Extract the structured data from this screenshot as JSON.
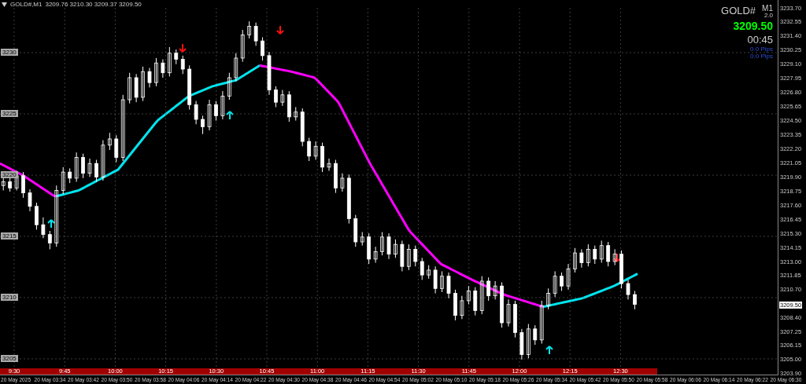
{
  "header": {
    "symbol": "GOLD#,M1",
    "quote": "3209.76 3210.30 3209.37 3209.50"
  },
  "info_panel": {
    "symbol": "GOLD#",
    "timeframe": "M1",
    "version": "2.0",
    "price": "3209.50",
    "countdown": "00:45",
    "pips": [
      "0.0 Pips",
      "0.0 Pips"
    ]
  },
  "price_chart": {
    "chart_data": {
      "type": "candlestick",
      "ylim": [
        3203.9,
        3233.7
      ],
      "grid": true,
      "yticks": [
        {
          "value": 3233.7,
          "label": "3233.70"
        },
        {
          "value": 3232.55,
          "label": "3232.55"
        },
        {
          "value": 3231.4,
          "label": "3231.40"
        },
        {
          "value": 3230.25,
          "label": "3230.25"
        },
        {
          "value": 3229.1,
          "label": "3229.10"
        },
        {
          "value": 3227.95,
          "label": "3227.95"
        },
        {
          "value": 3226.8,
          "label": "3226.80"
        },
        {
          "value": 3225.65,
          "label": "3225.65"
        },
        {
          "value": 3224.5,
          "label": "3224.50"
        },
        {
          "value": 3223.35,
          "label": "3223.35"
        },
        {
          "value": 3222.2,
          "label": "3222.20"
        },
        {
          "value": 3221.05,
          "label": "3221.05"
        },
        {
          "value": 3219.9,
          "label": "3219.90"
        },
        {
          "value": 3218.75,
          "label": "3218.75"
        },
        {
          "value": 3217.6,
          "label": "3217.60"
        },
        {
          "value": 3216.45,
          "label": "3216.45"
        },
        {
          "value": 3215.3,
          "label": "3215.30"
        },
        {
          "value": 3214.15,
          "label": "3214.15"
        },
        {
          "value": 3213.0,
          "label": "3213.00"
        },
        {
          "value": 3211.85,
          "label": "3211.85"
        },
        {
          "value": 3210.7,
          "label": "3210.70"
        },
        {
          "value": 3208.4,
          "label": "3208.40"
        },
        {
          "value": 3207.25,
          "label": "3207.25"
        },
        {
          "value": 3206.15,
          "label": "3206.15"
        },
        {
          "value": 3205.0,
          "label": "3205.00"
        },
        {
          "value": 3203.9,
          "label": "3203.90"
        }
      ],
      "categories": [
        null,
        null,
        null,
        null,
        null,
        null,
        null,
        null,
        null,
        null,
        null,
        null,
        null,
        null,
        null,
        null,
        null,
        null,
        null,
        null,
        null,
        null,
        null,
        null,
        null,
        null,
        null,
        null,
        null,
        null,
        null,
        null,
        null,
        null,
        null,
        null,
        null,
        null,
        null,
        null,
        null,
        null,
        null,
        null,
        null,
        null,
        null,
        null,
        null,
        null,
        null,
        null,
        null,
        null,
        null,
        null,
        null,
        null,
        null,
        null,
        null,
        null,
        null,
        null,
        null,
        null,
        null,
        null,
        null,
        null,
        null,
        null,
        null,
        null,
        null,
        null,
        null,
        null,
        null,
        null,
        null,
        null,
        null,
        null,
        null,
        null,
        null,
        null,
        null,
        null,
        null,
        null,
        null,
        null,
        null,
        null,
        null,
        null,
        null,
        null,
        null,
        null,
        null,
        null,
        null,
        null,
        null,
        null,
        null,
        null,
        null,
        null,
        null,
        null,
        null,
        null,
        null
      ],
      "ohlc": [
        [
          3219.2,
          3219.9,
          3218.8,
          3219.5
        ],
        [
          3219.5,
          3219.8,
          3218.7,
          3219.0
        ],
        [
          3219.0,
          3220.4,
          3218.8,
          3220.0
        ],
        [
          3220.0,
          3220.3,
          3218.2,
          3218.6
        ],
        [
          3218.6,
          3218.9,
          3217.1,
          3217.5
        ],
        [
          3217.5,
          3217.8,
          3215.6,
          3216.0
        ],
        [
          3216.0,
          3216.6,
          3214.9,
          3215.2
        ],
        [
          3215.2,
          3215.5,
          3214.0,
          3214.5
        ],
        [
          3214.5,
          3219.2,
          3214.2,
          3218.8
        ],
        [
          3218.8,
          3220.7,
          3218.5,
          3220.3
        ],
        [
          3220.3,
          3220.6,
          3219.4,
          3219.8
        ],
        [
          3219.8,
          3221.9,
          3219.5,
          3221.5
        ],
        [
          3221.5,
          3221.8,
          3219.8,
          3220.2
        ],
        [
          3220.2,
          3221.4,
          3219.9,
          3221.0
        ],
        [
          3221.0,
          3221.3,
          3219.5,
          3219.9
        ],
        [
          3219.9,
          3222.9,
          3219.6,
          3222.5
        ],
        [
          3222.5,
          3223.5,
          3222.1,
          3223.0
        ],
        [
          3223.0,
          3223.3,
          3221.1,
          3221.5
        ],
        [
          3221.5,
          3226.6,
          3221.2,
          3226.2
        ],
        [
          3226.2,
          3228.4,
          3225.9,
          3228.0
        ],
        [
          3228.0,
          3228.3,
          3226.0,
          3226.4
        ],
        [
          3226.4,
          3228.9,
          3226.1,
          3228.5
        ],
        [
          3228.5,
          3228.8,
          3227.2,
          3227.6
        ],
        [
          3227.6,
          3229.6,
          3227.3,
          3229.2
        ],
        [
          3229.2,
          3229.5,
          3228.0,
          3228.4
        ],
        [
          3228.4,
          3230.5,
          3228.1,
          3230.0
        ],
        [
          3230.0,
          3230.3,
          3229.1,
          3229.5
        ],
        [
          3229.5,
          3229.8,
          3228.3,
          3228.7
        ],
        [
          3228.7,
          3229.0,
          3225.4,
          3225.8
        ],
        [
          3225.8,
          3226.1,
          3224.2,
          3224.6
        ],
        [
          3224.6,
          3224.9,
          3223.4,
          3224.0
        ],
        [
          3224.0,
          3226.2,
          3223.7,
          3225.8
        ],
        [
          3225.8,
          3226.1,
          3224.5,
          3224.9
        ],
        [
          3224.9,
          3226.9,
          3224.6,
          3226.5
        ],
        [
          3226.5,
          3228.4,
          3226.2,
          3228.0
        ],
        [
          3228.0,
          3230.0,
          3227.7,
          3229.6
        ],
        [
          3229.6,
          3231.9,
          3229.3,
          3231.5
        ],
        [
          3231.5,
          3232.6,
          3231.2,
          3232.2
        ],
        [
          3232.2,
          3232.5,
          3230.6,
          3231.0
        ],
        [
          3231.0,
          3231.3,
          3229.4,
          3229.8
        ],
        [
          3229.8,
          3230.1,
          3226.6,
          3227.0
        ],
        [
          3227.0,
          3227.3,
          3225.6,
          3226.0
        ],
        [
          3226.0,
          3227.0,
          3225.7,
          3226.6
        ],
        [
          3226.6,
          3226.9,
          3224.4,
          3224.8
        ],
        [
          3224.8,
          3225.6,
          3224.5,
          3225.2
        ],
        [
          3225.2,
          3225.5,
          3222.4,
          3222.8
        ],
        [
          3222.8,
          3223.1,
          3221.2,
          3221.6
        ],
        [
          3221.6,
          3222.8,
          3221.3,
          3222.4
        ],
        [
          3222.4,
          3222.7,
          3220.3,
          3220.7
        ],
        [
          3220.7,
          3221.4,
          3220.4,
          3221.0
        ],
        [
          3221.0,
          3221.3,
          3218.6,
          3219.0
        ],
        [
          3219.0,
          3220.2,
          3218.7,
          3219.8
        ],
        [
          3219.8,
          3220.1,
          3216.1,
          3216.5
        ],
        [
          3216.5,
          3216.8,
          3214.2,
          3214.6
        ],
        [
          3214.6,
          3215.4,
          3214.3,
          3215.0
        ],
        [
          3215.0,
          3215.3,
          3212.8,
          3213.2
        ],
        [
          3213.2,
          3214.2,
          3212.9,
          3213.8
        ],
        [
          3213.8,
          3215.4,
          3213.5,
          3215.0
        ],
        [
          3215.0,
          3215.3,
          3213.2,
          3213.6
        ],
        [
          3213.6,
          3214.8,
          3213.3,
          3214.4
        ],
        [
          3214.4,
          3214.7,
          3212.2,
          3212.6
        ],
        [
          3212.6,
          3214.4,
          3212.3,
          3214.0
        ],
        [
          3214.0,
          3214.3,
          3212.6,
          3213.0
        ],
        [
          3213.0,
          3213.3,
          3211.5,
          3211.9
        ],
        [
          3211.9,
          3212.7,
          3211.6,
          3212.3
        ],
        [
          3212.3,
          3212.6,
          3210.4,
          3210.8
        ],
        [
          3210.8,
          3212.2,
          3210.5,
          3211.8
        ],
        [
          3211.8,
          3212.1,
          3210.0,
          3210.4
        ],
        [
          3210.4,
          3210.7,
          3208.2,
          3208.6
        ],
        [
          3208.6,
          3210.2,
          3208.3,
          3209.8
        ],
        [
          3209.8,
          3211.0,
          3209.5,
          3210.6
        ],
        [
          3210.6,
          3210.9,
          3208.6,
          3209.0
        ],
        [
          3209.0,
          3211.8,
          3208.7,
          3211.4
        ],
        [
          3211.4,
          3211.7,
          3209.8,
          3210.2
        ],
        [
          3210.2,
          3211.4,
          3209.9,
          3211.0
        ],
        [
          3211.0,
          3211.3,
          3207.6,
          3208.0
        ],
        [
          3208.0,
          3209.9,
          3207.7,
          3209.5
        ],
        [
          3209.5,
          3209.8,
          3206.8,
          3207.2
        ],
        [
          3207.2,
          3207.5,
          3205.0,
          3205.4
        ],
        [
          3205.4,
          3207.9,
          3205.1,
          3207.5
        ],
        [
          3207.5,
          3207.8,
          3206.2,
          3206.6
        ],
        [
          3206.6,
          3209.8,
          3206.3,
          3209.4
        ],
        [
          3209.4,
          3210.8,
          3209.1,
          3210.4
        ],
        [
          3210.4,
          3212.2,
          3210.1,
          3211.8
        ],
        [
          3211.8,
          3212.1,
          3210.6,
          3211.0
        ],
        [
          3211.0,
          3212.8,
          3210.7,
          3212.4
        ],
        [
          3212.4,
          3214.1,
          3212.1,
          3213.7
        ],
        [
          3213.7,
          3214.0,
          3212.5,
          3212.9
        ],
        [
          3212.9,
          3214.4,
          3212.6,
          3214.0
        ],
        [
          3214.0,
          3214.3,
          3212.8,
          3213.2
        ],
        [
          3213.2,
          3214.7,
          3212.9,
          3214.3
        ],
        [
          3214.3,
          3214.6,
          3212.6,
          3213.0
        ],
        [
          3213.0,
          3214.0,
          3212.7,
          3213.6
        ],
        [
          3213.6,
          3213.9,
          3210.8,
          3211.2
        ],
        [
          3211.2,
          3211.5,
          3209.9,
          3210.3
        ],
        [
          3210.3,
          3210.6,
          3209.1,
          3209.5
        ],
        null,
        null,
        null,
        null,
        null,
        null,
        null,
        null,
        null,
        null,
        null,
        null,
        null,
        null,
        null,
        null,
        null,
        null,
        null,
        null,
        null
      ]
    }
  },
  "price_axis": {
    "current_price": "3209.50"
  },
  "grid_labels": [
    "3230",
    "3225",
    "3220",
    "3215",
    "3210",
    "3205"
  ],
  "session_times": [
    "9:30",
    "9:45",
    "10:00",
    "10:15",
    "10:30",
    "10:45",
    "11:00",
    "11:15",
    "11:30",
    "11:45",
    "12:00",
    "12:15",
    "12:30"
  ],
  "time_axis": [
    "20 May 2025",
    "20 May 03:34",
    "20 May 03:42",
    "20 May 03:50",
    "20 May 03:58",
    "20 May 04:06",
    "20 May 04:14",
    "20 May 04:22",
    "20 May 04:30",
    "20 May 04:38",
    "20 May 04:46",
    "20 May 04:54",
    "20 May 05:02",
    "20 May 05:10",
    "20 May 05:18",
    "20 May 05:26",
    "20 May 05:34",
    "20 May 05:42",
    "20 May 05:50",
    "20 May 05:58",
    "20 May 06:06",
    "20 May 06:14",
    "20 May 06:22",
    "20 May 06:30"
  ]
}
